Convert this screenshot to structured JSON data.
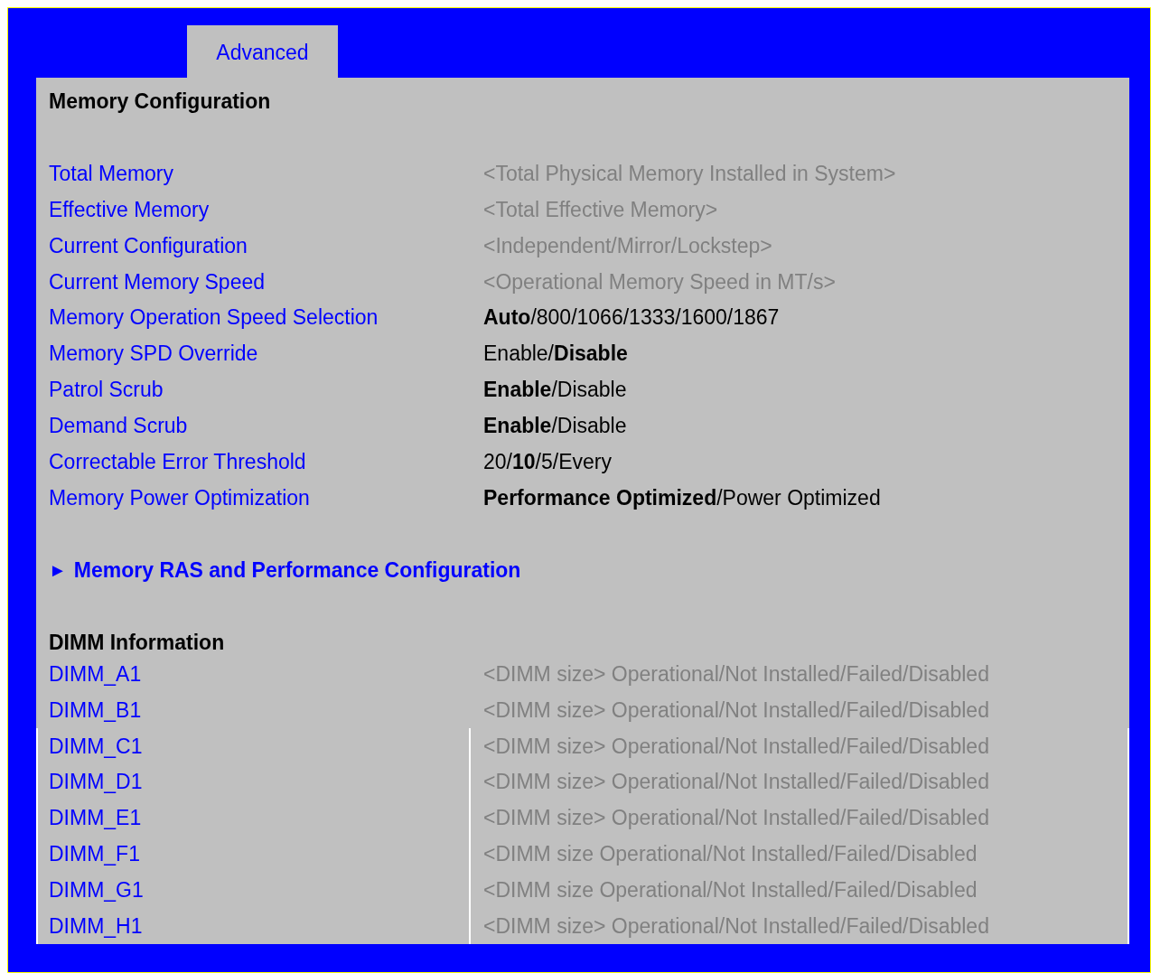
{
  "tabs": [
    {
      "label": "Advanced",
      "selected": true
    }
  ],
  "page_title": "Memory Configuration",
  "settings": [
    {
      "label": "Total Memory",
      "value": "<Total Physical Memory Installed in System>",
      "kind": "info"
    },
    {
      "label": "Effective Memory",
      "value": "<Total Effective Memory>",
      "kind": "info"
    },
    {
      "label": "Current Configuration",
      "value": "<Independent/Mirror/Lockstep>",
      "kind": "info"
    },
    {
      "label": "Current Memory Speed",
      "value": "<Operational Memory Speed in MT/s>",
      "kind": "info"
    },
    {
      "label": "Memory Operation Speed Selection",
      "value": "**Auto**/800/1066/1333/1600/1867",
      "kind": "option"
    },
    {
      "label": "Memory SPD Override",
      "value": "Enable/**Disable**",
      "kind": "option"
    },
    {
      "label": "Patrol Scrub",
      "value": "**Enable**/Disable",
      "kind": "option"
    },
    {
      "label": "Demand Scrub",
      "value": "**Enable**/Disable",
      "kind": "option"
    },
    {
      "label": "Correctable Error Threshold",
      "value": "20/**10**/5/Every",
      "kind": "option"
    },
    {
      "label": "Memory Power Optimization",
      "value": "**Performance Optimized**/Power Optimized",
      "kind": "option"
    }
  ],
  "submenus": [
    {
      "marker": "►",
      "label": "Memory RAS and Performance Configuration"
    }
  ],
  "dimm_section": {
    "heading": "DIMM Information",
    "rows": [
      {
        "label": "DIMM_A1",
        "value": "<DIMM size> Operational/Not Installed/Failed/Disabled",
        "outlined": false
      },
      {
        "label": "DIMM_B1",
        "value": "<DIMM size> Operational/Not Installed/Failed/Disabled",
        "outlined": false
      },
      {
        "label": "DIMM_C1",
        "value": "<DIMM size> Operational/Not Installed/Failed/Disabled",
        "outlined": true
      },
      {
        "label": "DIMM_D1",
        "value": "<DIMM size> Operational/Not Installed/Failed/Disabled",
        "outlined": true
      },
      {
        "label": "DIMM_E1",
        "value": "<DIMM size> Operational/Not Installed/Failed/Disabled",
        "outlined": true
      },
      {
        "label": "DIMM_F1",
        "value": "<DIMM size Operational/Not Installed/Failed/Disabled",
        "outlined": true
      },
      {
        "label": "DIMM_G1",
        "value": "<DIMM size Operational/Not Installed/Failed/Disabled",
        "outlined": true
      },
      {
        "label": "DIMM_H1",
        "value": "<DIMM size> Operational/Not Installed/Failed/Disabled",
        "outlined": true
      }
    ]
  }
}
